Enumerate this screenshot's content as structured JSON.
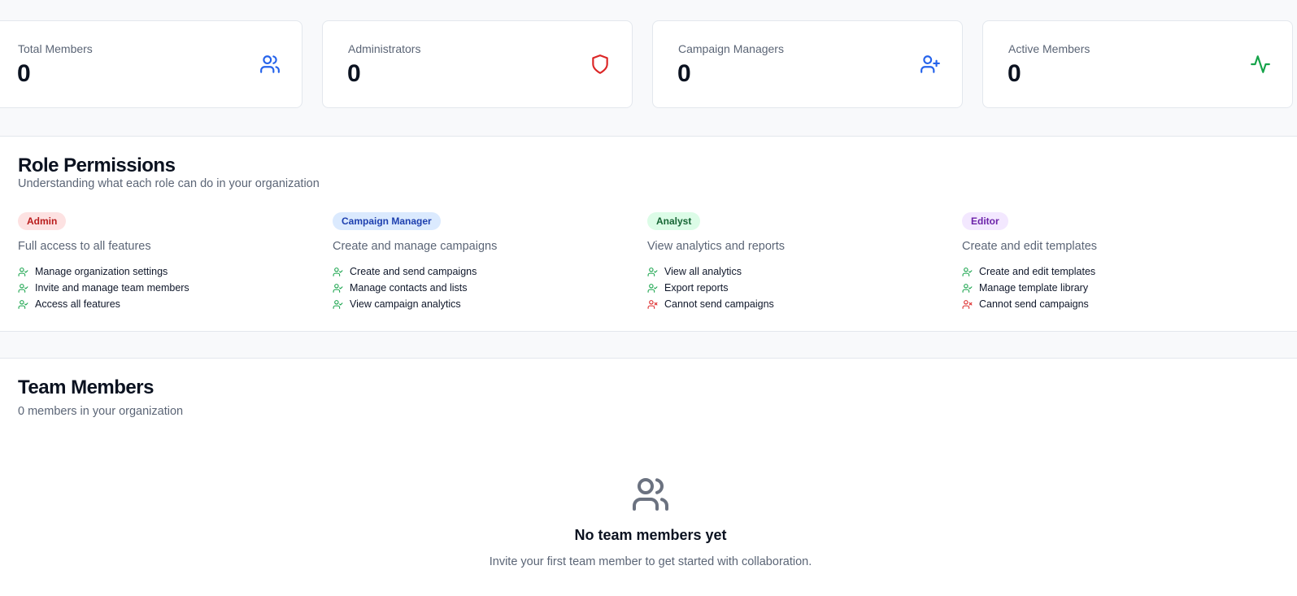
{
  "stats": [
    {
      "label": "Total Members",
      "value": "0",
      "icon": "users-icon",
      "color": "#2563eb"
    },
    {
      "label": "Administrators",
      "value": "0",
      "icon": "shield-icon",
      "color": "#dc2626"
    },
    {
      "label": "Campaign Managers",
      "value": "0",
      "icon": "user-plus-icon",
      "color": "#2563eb"
    },
    {
      "label": "Active Members",
      "value": "0",
      "icon": "activity-icon",
      "color": "#16a34a"
    }
  ],
  "roles_panel": {
    "title": "Role Permissions",
    "subtitle": "Understanding what each role can do in your organization",
    "roles": [
      {
        "badge": "Admin",
        "badge_bg": "#fde2e2",
        "badge_fg": "#b91c1c",
        "description": "Full access to all features",
        "permissions": [
          {
            "text": "Manage organization settings",
            "allowed": true
          },
          {
            "text": "Invite and manage team members",
            "allowed": true
          },
          {
            "text": "Access all features",
            "allowed": true
          }
        ]
      },
      {
        "badge": "Campaign Manager",
        "badge_bg": "#dbeafe",
        "badge_fg": "#1e40af",
        "description": "Create and manage campaigns",
        "permissions": [
          {
            "text": "Create and send campaigns",
            "allowed": true
          },
          {
            "text": "Manage contacts and lists",
            "allowed": true
          },
          {
            "text": "View campaign analytics",
            "allowed": true
          }
        ]
      },
      {
        "badge": "Analyst",
        "badge_bg": "#dcfce7",
        "badge_fg": "#166534",
        "description": "View analytics and reports",
        "permissions": [
          {
            "text": "View all analytics",
            "allowed": true
          },
          {
            "text": "Export reports",
            "allowed": true
          },
          {
            "text": "Cannot send campaigns",
            "allowed": false
          }
        ]
      },
      {
        "badge": "Editor",
        "badge_bg": "#f3e8ff",
        "badge_fg": "#6b21a8",
        "description": "Create and edit templates",
        "permissions": [
          {
            "text": "Create and edit templates",
            "allowed": true
          },
          {
            "text": "Manage template library",
            "allowed": true
          },
          {
            "text": "Cannot send campaigns",
            "allowed": false
          }
        ]
      }
    ]
  },
  "team_panel": {
    "title": "Team Members",
    "subtitle": "0 members in your organization",
    "empty_icon": "users-icon",
    "empty_title": "No team members yet",
    "empty_text": "Invite your first team member to get started with collaboration."
  },
  "colors": {
    "allowed": "#16a34a",
    "denied": "#dc2626",
    "muted_icon": "#6b7280"
  }
}
